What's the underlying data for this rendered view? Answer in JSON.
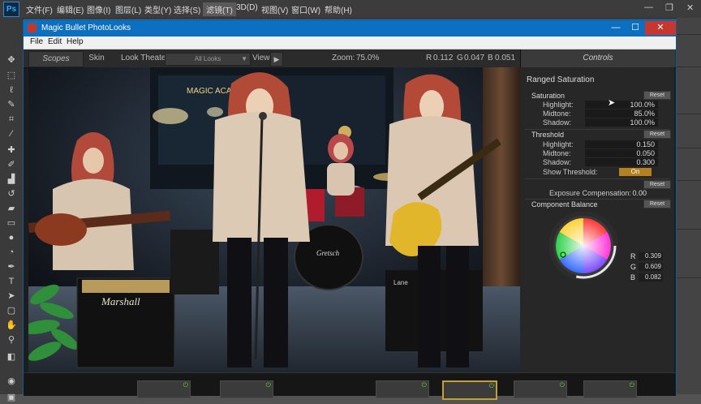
{
  "photoshop": {
    "menu": [
      "文件(F)",
      "编辑(E)",
      "图像(I)",
      "图层(L)",
      "类型(Y)",
      "选择(S)",
      "滤镜(T)",
      "3D(D)",
      "视图(V)",
      "窗口(W)",
      "帮助(H)"
    ],
    "active_menu_index": 6
  },
  "window": {
    "title": "Magic Bullet PhotoLooks",
    "menu": [
      "File",
      "Edit",
      "Help"
    ]
  },
  "toolbar": {
    "scopes": "Scopes",
    "skin": "Skin",
    "look_theater": "Look Theater",
    "looks_select": "All Looks",
    "view": "View",
    "zoom_label": "Zoom:",
    "zoom_value": "75.0%",
    "r_label": "R",
    "r_value": "0.112",
    "g_label": "G",
    "g_value": "0.047",
    "b_label": "B",
    "b_value": "0.051"
  },
  "controls": {
    "tab": "Controls",
    "section": "Ranged Saturation",
    "saturation": {
      "title": "Saturation",
      "reset": "Reset",
      "rows": [
        {
          "label": "Highlight:",
          "value": "100.0%"
        },
        {
          "label": "Midtone:",
          "value": "85.0%"
        },
        {
          "label": "Shadow:",
          "value": "100.0%"
        }
      ]
    },
    "threshold": {
      "title": "Threshold",
      "reset": "Reset",
      "rows": [
        {
          "label": "Highlight:",
          "value": "0.150"
        },
        {
          "label": "Midtone:",
          "value": "0.050"
        },
        {
          "label": "Shadow:",
          "value": "0.300"
        }
      ],
      "show_label": "Show Threshold:",
      "show_value": "On"
    },
    "exposure": {
      "reset": "Reset",
      "label": "Exposure Compensation:",
      "value": "0.00"
    },
    "component_balance": {
      "title": "Component Balance",
      "reset": "Reset",
      "r_label": "R",
      "r_value": "0.309",
      "g_label": "G",
      "g_value": "0.609",
      "b_label": "B",
      "b_value": "0.082"
    }
  },
  "photo": {
    "sign_text": "MAGIC ACADEMY",
    "amp_brand": "Marshall",
    "drum_brand": "Gretsch",
    "amp_brand_2": "Lane"
  },
  "colors": {
    "accent_blue": "#0c6fc0",
    "on_button": "#b5811f",
    "power_green": "#5bd236",
    "selected_card": "#c6a12a"
  }
}
